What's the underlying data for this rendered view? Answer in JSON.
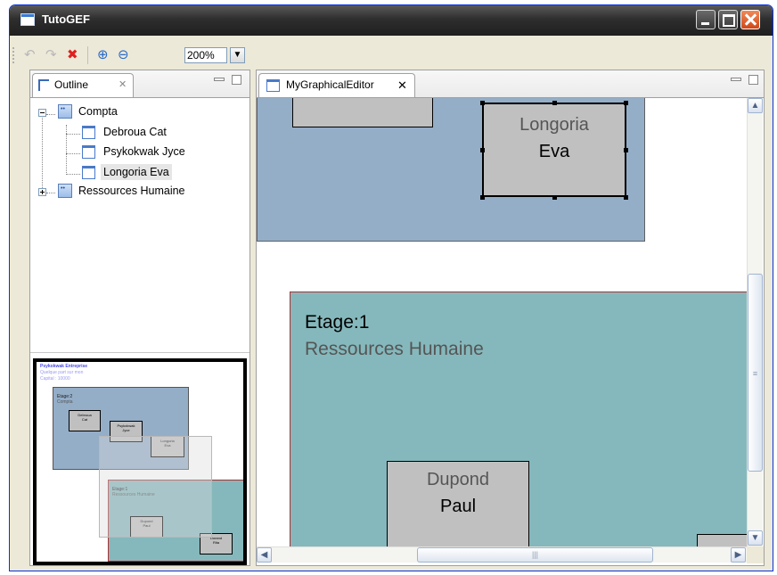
{
  "window": {
    "title": "TutoGEF"
  },
  "toolbar": {
    "zoom_value": "200%"
  },
  "outline": {
    "tab_label": "Outline",
    "tree": {
      "groups": [
        {
          "label": "Compta",
          "expanded": true,
          "children": [
            "Debroua Cat",
            "Psykokwak Jyce",
            "Longoria Eva"
          ],
          "selected_child": "Longoria Eva"
        },
        {
          "label": "Ressources Humaine",
          "expanded": false
        }
      ]
    },
    "overview": {
      "top_text": [
        "Psykokwak Entreprise",
        "Quelque part sur mon",
        "Capital : 10000"
      ],
      "compta": {
        "etage": "Etage:2",
        "name": "Compta"
      },
      "rh": {
        "etage": "Etage:1",
        "name": "Ressources Humaine"
      },
      "employees": [
        {
          "line1": "Debroua",
          "line2": "Cat"
        },
        {
          "line1": "Psykokwak",
          "line2": "Jyce"
        },
        {
          "line1": "Longoria",
          "line2": "Eva"
        },
        {
          "line1": "Dupond",
          "line2": "Paul"
        },
        {
          "line1": "Durand",
          "line2": "Rita"
        }
      ]
    }
  },
  "editor": {
    "tab_label": "MyGraphicalEditor",
    "selected_employee": {
      "first": "Longoria",
      "last": "Eva"
    },
    "service": {
      "etage": "Etage:1",
      "name": "Ressources Humaine"
    },
    "employee": {
      "first": "Dupond",
      "last": "Paul"
    }
  },
  "colors": {
    "compta_fill": "#94aec8",
    "rh_fill": "#85b8bc",
    "rh_border": "#b03030",
    "employee_fill": "#c0c0c0",
    "service_name_text": "#555555"
  }
}
